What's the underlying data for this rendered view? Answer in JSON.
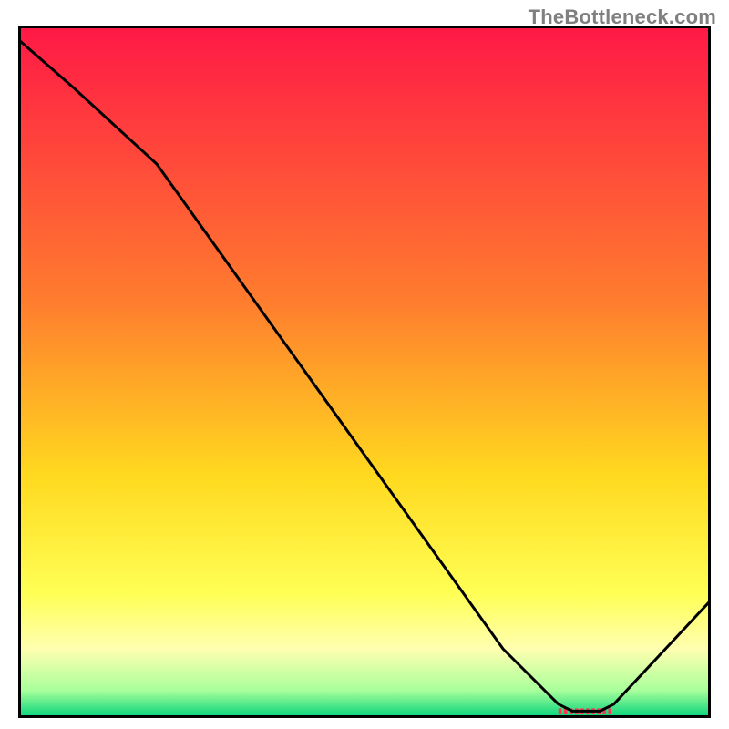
{
  "watermark": "TheBottleneck.com",
  "chart_data": {
    "type": "line",
    "title": "",
    "xlabel": "",
    "ylabel": "",
    "xlim": [
      0,
      100
    ],
    "ylim": [
      0,
      100
    ],
    "grid": false,
    "x": [
      0,
      8,
      20,
      30,
      40,
      50,
      60,
      70,
      78,
      80,
      82,
      84,
      86,
      100
    ],
    "values": [
      98,
      91,
      80,
      66,
      52,
      38,
      24,
      10,
      2,
      1,
      1,
      1,
      2,
      17
    ],
    "background_gradient": {
      "stops": [
        {
          "offset": 0,
          "color": "#ff1846"
        },
        {
          "offset": 40,
          "color": "#ff7d2e"
        },
        {
          "offset": 65,
          "color": "#ffd91f"
        },
        {
          "offset": 82,
          "color": "#ffff55"
        },
        {
          "offset": 90,
          "color": "#ffffb0"
        },
        {
          "offset": 96,
          "color": "#a9ff9b"
        },
        {
          "offset": 100,
          "color": "#00d27a"
        }
      ]
    },
    "marker_band": {
      "x_start": 78,
      "x_end": 86,
      "y": 1,
      "color": "#ff3352"
    },
    "border_color": "#000000",
    "line_color": "#000000"
  }
}
